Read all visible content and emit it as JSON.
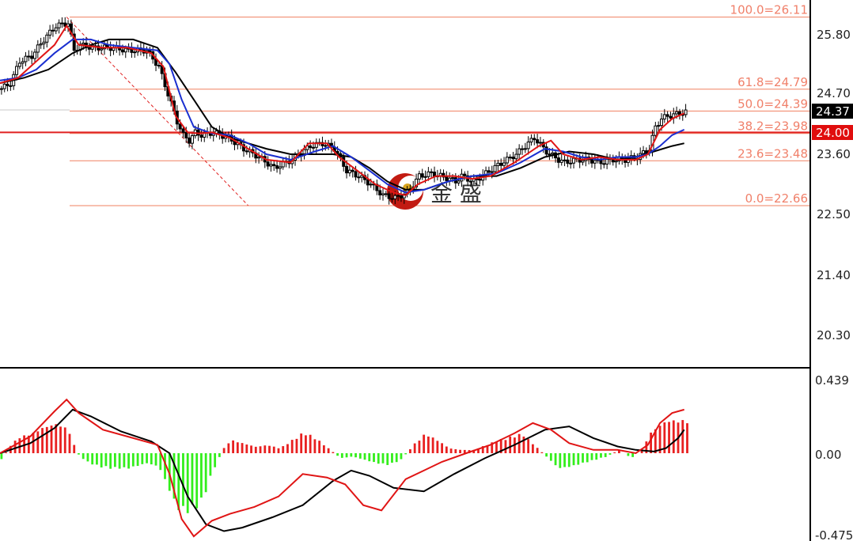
{
  "colors": {
    "background": "#ffffff",
    "fib_line": "#f08060",
    "fib_text": "#f0806a",
    "support_line": "#e02020",
    "candle": "#000000",
    "ma_black": "#000000",
    "ma_blue": "#1a2fd0",
    "ma_red": "#e01515",
    "macd_up": "#e82020",
    "macd_down": "#33ee1c",
    "dashed": "#e02020",
    "price_tag_black": "#000000",
    "price_tag_red": "#e00d0d",
    "watermark_ring": "#c21b12",
    "watermark_dot": "#d9a520",
    "watermark_text": "#333333"
  },
  "price_axis": {
    "ticks": [
      "25.80",
      "24.70",
      "23.60",
      "22.50",
      "21.40",
      "20.30"
    ]
  },
  "macd_axis": {
    "ticks": [
      "0.439",
      "0.00",
      "-0.475"
    ]
  },
  "price_tags": {
    "current": "24.37",
    "support": "24.00"
  },
  "watermark": {
    "text": "金 盛"
  },
  "chart_data": [
    {
      "type": "line",
      "panel": "price",
      "ylim": [
        19.8,
        26.3
      ],
      "x_count": 230,
      "fib_levels": [
        {
          "label": "100.0=26.11",
          "value": 26.11
        },
        {
          "label": "61.8=24.79",
          "value": 24.79
        },
        {
          "label": "50.0=24.39",
          "value": 24.39
        },
        {
          "label": "38.2=23.98",
          "value": 23.98
        },
        {
          "label": "23.6=23.48",
          "value": 23.48
        },
        {
          "label": "0.0=22.66",
          "value": 22.66
        }
      ],
      "support_level": 24.0,
      "current_price": 24.37,
      "fib_swing": {
        "start": [
          22,
          26.11
        ],
        "end": [
          82,
          22.66
        ]
      },
      "series": [
        {
          "role": "close",
          "x": [
            0,
            3,
            6,
            10,
            14,
            18,
            22,
            24,
            26,
            30,
            36,
            42,
            48,
            52,
            55,
            58,
            60,
            62,
            64,
            66,
            70,
            75,
            80,
            85,
            90,
            96,
            102,
            106,
            110,
            114,
            118,
            122,
            126,
            130,
            134,
            138,
            142,
            148,
            150,
            152,
            156,
            160,
            164,
            170,
            176,
            180,
            184,
            186,
            190,
            194,
            198,
            202,
            206,
            210,
            214,
            216,
            218,
            220,
            222,
            224,
            226
          ],
          "values": [
            24.8,
            24.9,
            25.3,
            25.4,
            25.7,
            25.95,
            26.0,
            25.5,
            25.6,
            25.55,
            25.55,
            25.5,
            25.5,
            25.2,
            24.7,
            24.2,
            23.95,
            23.85,
            24.0,
            23.95,
            24.0,
            23.9,
            23.7,
            23.55,
            23.35,
            23.5,
            23.75,
            23.8,
            23.7,
            23.3,
            23.2,
            23.05,
            22.85,
            22.8,
            22.9,
            23.2,
            23.25,
            23.15,
            23.1,
            23.2,
            23.1,
            23.25,
            23.4,
            23.6,
            23.9,
            23.65,
            23.5,
            23.45,
            23.5,
            23.5,
            23.45,
            23.5,
            23.5,
            23.55,
            23.7,
            24.1,
            24.25,
            24.3,
            24.32,
            24.35,
            24.37
          ]
        },
        {
          "role": "ma_red",
          "x": [
            0,
            6,
            12,
            18,
            22,
            26,
            34,
            42,
            50,
            54,
            58,
            62,
            66,
            70,
            76,
            82,
            88,
            96,
            102,
            108,
            112,
            118,
            124,
            130,
            134,
            138,
            144,
            150,
            156,
            162,
            170,
            178,
            182,
            186,
            192,
            198,
            204,
            210,
            214,
            218,
            222,
            226
          ],
          "values": [
            24.9,
            25.0,
            25.3,
            25.6,
            25.95,
            25.6,
            25.55,
            25.55,
            25.45,
            25.2,
            24.3,
            24.0,
            23.98,
            24.0,
            23.9,
            23.7,
            23.5,
            23.45,
            23.8,
            23.8,
            23.55,
            23.3,
            23.05,
            22.9,
            22.85,
            23.05,
            23.2,
            23.2,
            23.15,
            23.2,
            23.45,
            23.75,
            23.85,
            23.6,
            23.5,
            23.55,
            23.5,
            23.5,
            23.6,
            24.05,
            24.25,
            24.35
          ]
        },
        {
          "role": "ma_blue",
          "x": [
            0,
            6,
            12,
            18,
            24,
            30,
            36,
            44,
            52,
            56,
            60,
            64,
            70,
            76,
            82,
            88,
            96,
            104,
            110,
            116,
            122,
            128,
            134,
            140,
            148,
            156,
            164,
            172,
            180,
            186,
            192,
            198,
            204,
            210,
            214,
            218,
            222,
            226
          ],
          "values": [
            24.95,
            25.0,
            25.15,
            25.45,
            25.7,
            25.7,
            25.6,
            25.55,
            25.5,
            25.25,
            24.6,
            24.1,
            23.98,
            23.95,
            23.8,
            23.6,
            23.5,
            23.65,
            23.75,
            23.55,
            23.3,
            23.05,
            22.9,
            22.95,
            23.1,
            23.2,
            23.25,
            23.45,
            23.7,
            23.65,
            23.55,
            23.5,
            23.55,
            23.55,
            23.6,
            23.75,
            23.95,
            24.05
          ]
        },
        {
          "role": "ma_black",
          "x": [
            0,
            8,
            16,
            24,
            30,
            36,
            44,
            52,
            58,
            64,
            70,
            76,
            82,
            88,
            96,
            104,
            110,
            116,
            122,
            128,
            134,
            140,
            148,
            156,
            164,
            172,
            180,
            188,
            196,
            204,
            210,
            216,
            222,
            226
          ],
          "values": [
            24.9,
            25.0,
            25.15,
            25.45,
            25.6,
            25.7,
            25.7,
            25.55,
            25.1,
            24.6,
            24.1,
            23.9,
            23.8,
            23.7,
            23.6,
            23.6,
            23.6,
            23.55,
            23.35,
            23.1,
            22.95,
            22.95,
            23.1,
            23.2,
            23.2,
            23.35,
            23.55,
            23.65,
            23.6,
            23.5,
            23.55,
            23.65,
            23.75,
            23.8
          ]
        }
      ]
    },
    {
      "type": "bar",
      "panel": "macd",
      "ylim": [
        -0.475,
        0.439
      ],
      "x_count": 230,
      "histogram": {
        "x": [
          0,
          3,
          6,
          10,
          14,
          18,
          22,
          25,
          28,
          32,
          36,
          42,
          48,
          52,
          55,
          58,
          62,
          66,
          70,
          74,
          76,
          80,
          84,
          88,
          92,
          96,
          100,
          104,
          108,
          112,
          116,
          120,
          124,
          128,
          132,
          136,
          140,
          144,
          148,
          152,
          156,
          160,
          164,
          168,
          172,
          176,
          180,
          184,
          188,
          192,
          196,
          200,
          204,
          208,
          212,
          214,
          216,
          218,
          220,
          222,
          224,
          226
        ],
        "values": [
          -0.04,
          0.05,
          0.1,
          0.12,
          0.16,
          0.18,
          0.15,
          0.0,
          -0.05,
          -0.08,
          -0.09,
          -0.09,
          -0.06,
          -0.08,
          -0.2,
          -0.33,
          -0.35,
          -0.3,
          -0.1,
          0.05,
          0.08,
          0.06,
          0.04,
          0.05,
          0.03,
          0.08,
          0.13,
          0.09,
          0.03,
          -0.03,
          -0.02,
          -0.04,
          -0.06,
          -0.07,
          -0.04,
          0.05,
          0.12,
          0.08,
          0.03,
          0.02,
          0.02,
          0.05,
          0.08,
          0.1,
          0.12,
          0.05,
          -0.02,
          -0.09,
          -0.08,
          -0.06,
          -0.04,
          -0.02,
          0.02,
          -0.03,
          0.03,
          0.12,
          0.15,
          0.18,
          0.2,
          0.2,
          0.2,
          0.2
        ]
      },
      "series": [
        {
          "role": "signal_black",
          "x": [
            0,
            10,
            18,
            24,
            30,
            40,
            50,
            56,
            62,
            68,
            74,
            80,
            90,
            100,
            110,
            116,
            122,
            130,
            140,
            150,
            160,
            170,
            180,
            188,
            196,
            204,
            210,
            216,
            220,
            224,
            226
          ],
          "values": [
            0.0,
            0.06,
            0.15,
            0.26,
            0.22,
            0.13,
            0.07,
            0.0,
            -0.25,
            -0.41,
            -0.45,
            -0.43,
            -0.37,
            -0.3,
            -0.16,
            -0.1,
            -0.13,
            -0.2,
            -0.22,
            -0.12,
            -0.03,
            0.05,
            0.14,
            0.16,
            0.09,
            0.04,
            0.02,
            0.01,
            0.03,
            0.09,
            0.14
          ]
        },
        {
          "role": "macd_red",
          "x": [
            0,
            10,
            18,
            22,
            26,
            34,
            44,
            52,
            56,
            60,
            64,
            70,
            76,
            84,
            92,
            100,
            108,
            114,
            120,
            126,
            134,
            140,
            146,
            154,
            162,
            170,
            176,
            182,
            188,
            196,
            204,
            210,
            214,
            218,
            222,
            226
          ],
          "values": [
            0.0,
            0.1,
            0.25,
            0.32,
            0.24,
            0.14,
            0.09,
            0.05,
            -0.12,
            -0.38,
            -0.48,
            -0.39,
            -0.35,
            -0.31,
            -0.25,
            -0.12,
            -0.14,
            -0.18,
            -0.3,
            -0.33,
            -0.15,
            -0.1,
            -0.05,
            0.0,
            0.05,
            0.12,
            0.18,
            0.14,
            0.06,
            0.02,
            0.02,
            0.0,
            0.05,
            0.18,
            0.24,
            0.26
          ]
        }
      ]
    }
  ]
}
